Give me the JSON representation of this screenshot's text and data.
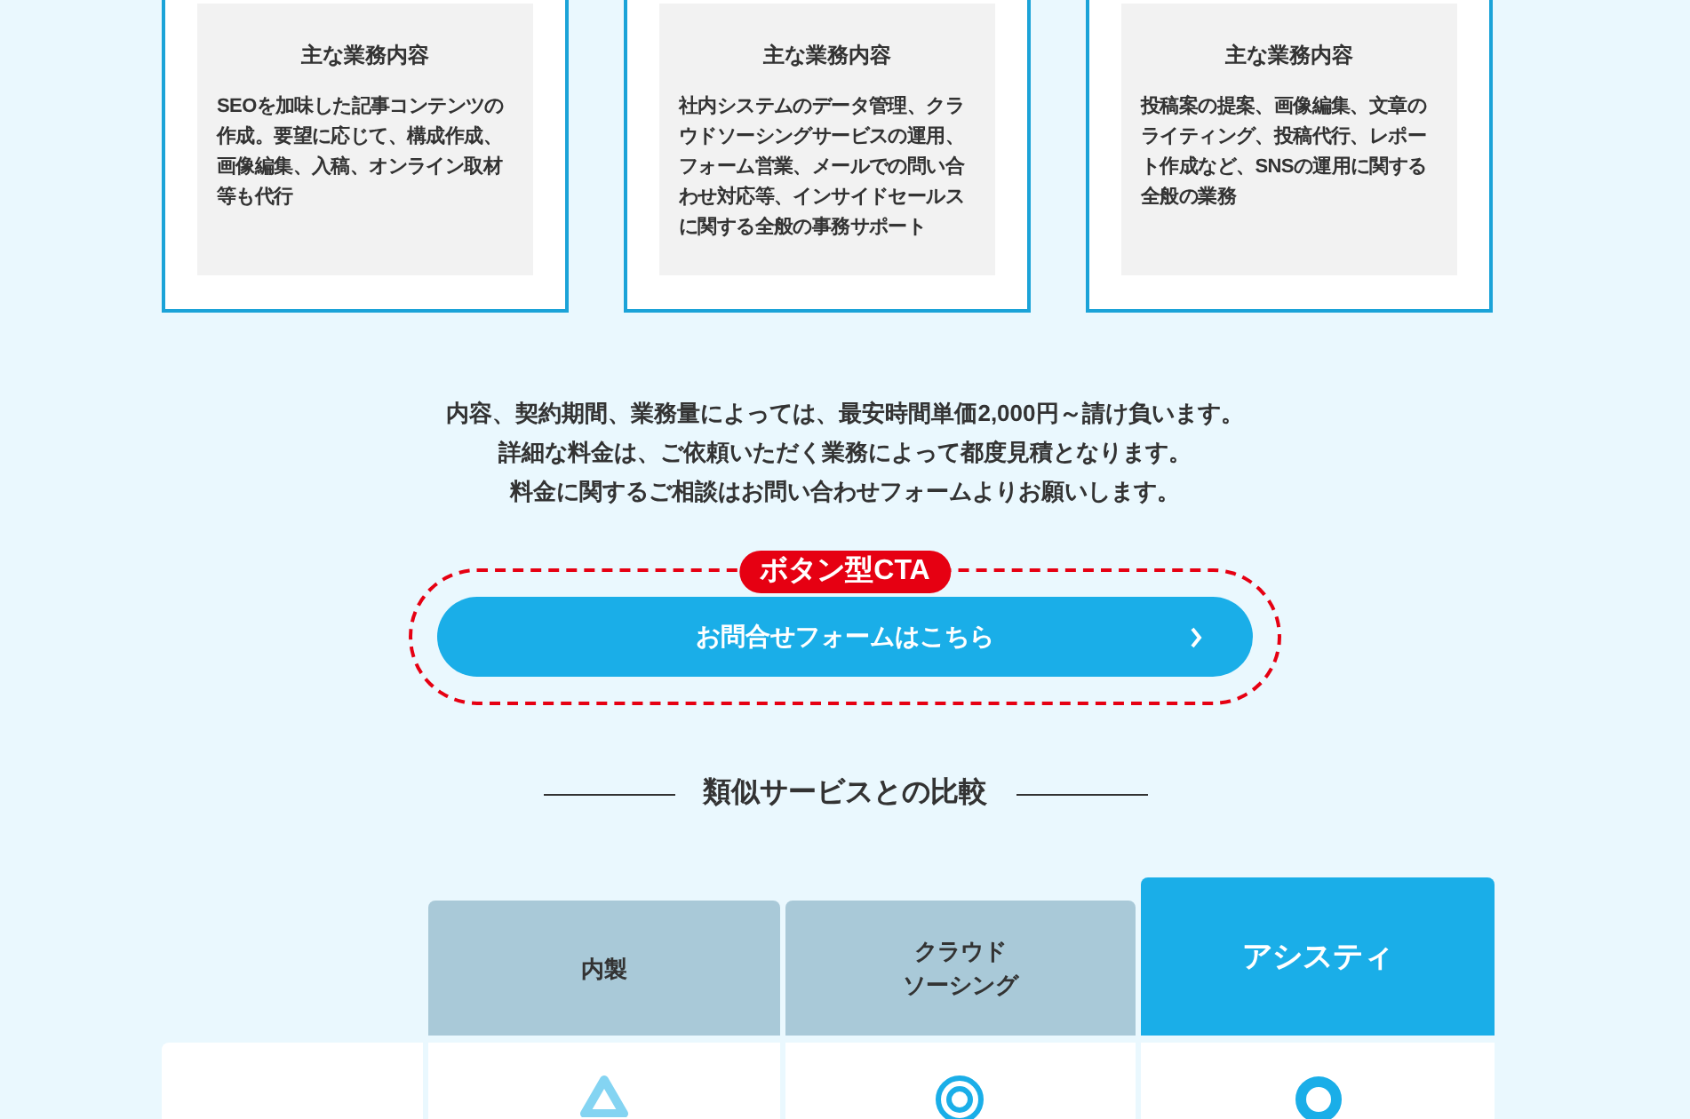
{
  "service_cards": [
    {
      "heading": "主な業務内容",
      "body": "SEOを加味した記事コンテンツの作成。要望に応じて、構成作成、画像編集、入稿、オンライン取材等も代行"
    },
    {
      "heading": "主な業務内容",
      "body": "社内システムのデータ管理、クラウドソーシングサービスの運用、フォーム営業、メールでの問い合わせ対応等、インサイドセールスに関する全般の事務サポート"
    },
    {
      "heading": "主な業務内容",
      "body": "投稿案の提案、画像編集、文章のライティング、投稿代行、レポート作成など、SNSの運用に関する全般の業務"
    }
  ],
  "pricing_note": [
    "内容、契約期間、業務量によっては、最安時間単価2,000円～請け負います。",
    "詳細な料金は、ご依頼いただく業務によって都度見積となります。",
    "料金に関するご相談はお問い合わせフォームよりお願いします。"
  ],
  "cta": {
    "badge": "ボタン型CTA",
    "button": "お問合せフォームはこちら"
  },
  "comparison": {
    "title": "類似サービスとの比較",
    "columns": [
      {
        "lines": [
          "内製"
        ],
        "highlighted": false
      },
      {
        "lines": [
          "クラウド",
          "ソーシング"
        ],
        "highlighted": false
      },
      {
        "lines": [
          "アシスティ"
        ],
        "highlighted": true
      }
    ],
    "rows": [
      {
        "marks": [
          {
            "kind": "triangle"
          },
          {
            "kind": "double-circle"
          },
          {
            "kind": "circle"
          }
        ]
      }
    ]
  }
}
